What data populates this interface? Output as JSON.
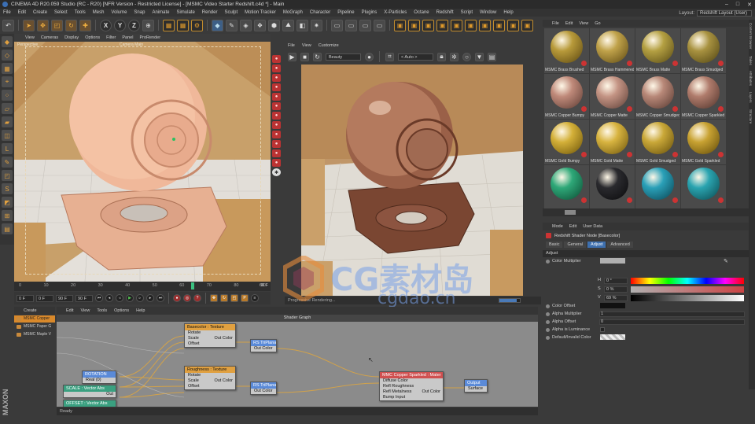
{
  "title_bar": {
    "text": "CINEMA 4D R20.059 Studio (RC - R20) [NFR Version - Restricted License] - [MSMC Video Starter Redshift.c4d *] - Main"
  },
  "menu": [
    "File",
    "Edit",
    "Create",
    "Select",
    "Tools",
    "Mesh",
    "Volume",
    "Snap",
    "Animate",
    "Simulate",
    "Render",
    "Sculpt",
    "Motion Tracker",
    "MoGraph",
    "Character",
    "Pipeline",
    "Plugins",
    "X-Particles",
    "Octane",
    "Redshift",
    "Script",
    "Window",
    "Help"
  ],
  "layout": {
    "label": "Layout:",
    "value": "Redshift Layout (User)"
  },
  "toolbar": {
    "axis": [
      "X",
      "Y",
      "Z"
    ]
  },
  "viewport": {
    "menu": [
      "View",
      "Cameras",
      "Display",
      "Options",
      "Filter",
      "Panel",
      "ProRender"
    ],
    "label_left": "Perspective",
    "label_cam": "Camera Main"
  },
  "timeline": {
    "ticks": [
      "0",
      "10",
      "20",
      "30",
      "40",
      "50",
      "60",
      "70",
      "80",
      "90"
    ],
    "current": "66.70",
    "end_label": "66 F",
    "start_field": "0 F",
    "min_field": "0 F",
    "max_field": "90 F",
    "end_field": "90 F",
    "current_value": 66.7,
    "range_max": 90
  },
  "render_view": {
    "menu": [
      "File",
      "View",
      "Customize"
    ],
    "beauty": "Beauty",
    "auto": "< Auto >",
    "status": "Progressive Rendering...",
    "progress": 0.85
  },
  "material_browser": {
    "menu": [
      "File",
      "Edit",
      "View",
      "Go"
    ],
    "materials": [
      {
        "name": "MSMC Brass Brushed",
        "color": "#b89a3a",
        "shade": "#5a4610"
      },
      {
        "name": "MSMC Brass Hammered",
        "color": "#c0a24a",
        "shade": "#5c4812"
      },
      {
        "name": "MSMC Brass Matte",
        "color": "#b4a042",
        "shade": "#564814"
      },
      {
        "name": "MSMC Brass Smudged",
        "color": "#a89240",
        "shade": "#4e4212"
      },
      {
        "name": "MSMC Copper Bumpy",
        "color": "#c08a7a",
        "shade": "#5a3a32"
      },
      {
        "name": "MSMC Copper Matte",
        "color": "#c49484",
        "shade": "#5c3e36"
      },
      {
        "name": "MSMC Copper Smudged",
        "color": "#b88878",
        "shade": "#553830"
      },
      {
        "name": "MSMC Copper Sparkled",
        "color": "#b07c6c",
        "shade": "#4e322a"
      },
      {
        "name": "MSMC Gold Bumpy",
        "color": "#d4b038",
        "shade": "#6a5208"
      },
      {
        "name": "MSMC Gold Matte",
        "color": "#d8b440",
        "shade": "#6c540c"
      },
      {
        "name": "MSMC Gold Smudged",
        "color": "#caa838",
        "shade": "#624c0a"
      },
      {
        "name": "MSMC Gold Sparkled",
        "color": "#c8a232",
        "shade": "#5e4808"
      },
      {
        "name": "",
        "color": "#2ea878",
        "shade": "#0c4a32"
      },
      {
        "name": "",
        "color": "#2a2a2e",
        "shade": "#0a0a0c"
      },
      {
        "name": "",
        "color": "#2aa0b8",
        "shade": "#0a4250"
      },
      {
        "name": "",
        "color": "#2aa4b0",
        "shade": "#0a464c"
      }
    ]
  },
  "attribute_manager": {
    "menu": [
      "Mode",
      "Edit",
      "User Data"
    ],
    "title": "Redshift Shader Node [Basecolor]",
    "tabs": [
      "Basic",
      "General",
      "Adjust",
      "Advanced"
    ],
    "active_tab": "Adjust",
    "section": "Adjust",
    "color_multiplier": "Color Multiplier",
    "hsv": [
      {
        "label": "H",
        "value": "0 °"
      },
      {
        "label": "S",
        "value": "0 %"
      },
      {
        "label": "V",
        "value": "69 %"
      }
    ],
    "rows": [
      {
        "label": "Color Offset",
        "value": ""
      },
      {
        "label": "Alpha Multiplier",
        "value": "1"
      },
      {
        "label": "Alpha Offset",
        "value": "0"
      },
      {
        "label": "Alpha is Luminance",
        "value": ""
      },
      {
        "label": "Default/Invalid Color",
        "value": ""
      }
    ]
  },
  "object_manager": {
    "tab": "Create",
    "items": [
      "MSMC Copper",
      "MSMC Paper G",
      "MSMC Maple V"
    ]
  },
  "node_editor": {
    "menu": [
      "Edit",
      "View",
      "Tools",
      "Options",
      "Help"
    ],
    "title": "Shader Graph",
    "nodes": {
      "basecolor": {
        "title": "Basecolor : Texture",
        "inputs": [
          "Rotate",
          "Scale",
          "Offset"
        ],
        "output": "Out Color"
      },
      "triplanar1": {
        "title": "RS TriPlanar",
        "output": "Out Color"
      },
      "roughness": {
        "title": "Roughness : Texture",
        "inputs": [
          "Rotate",
          "Scale",
          "Offset"
        ],
        "output": "Out Color"
      },
      "triplanar2": {
        "title": "RS TriPlanar",
        "output": "Out Color"
      },
      "rotation": {
        "title": "ROTATION",
        "row": "Real (0)",
        "output": "Out"
      },
      "scale": {
        "title": "SCALE : Vector Abs",
        "output": "Out"
      },
      "offset": {
        "title": "OFFSET : Vector Abs"
      },
      "material": {
        "title": "MMC Copper Sparkled : Mater",
        "inputs": [
          "Diffuse Color",
          "Refl Roughness",
          "Refl Metalness",
          "Bump Input"
        ],
        "output": "Out Color"
      },
      "output": {
        "title": "Output",
        "input": "Surface"
      }
    },
    "status": "Ready"
  },
  "right_tabs": [
    "Content Browser",
    "Takes",
    "Attributes",
    "Layers",
    "Structure"
  ],
  "watermark": {
    "brand": "CG素材岛",
    "url": "cgdao.cn"
  },
  "colors": {
    "accent": "#3d6fae",
    "selection": "#d9892b",
    "render_red": "#b33333"
  }
}
